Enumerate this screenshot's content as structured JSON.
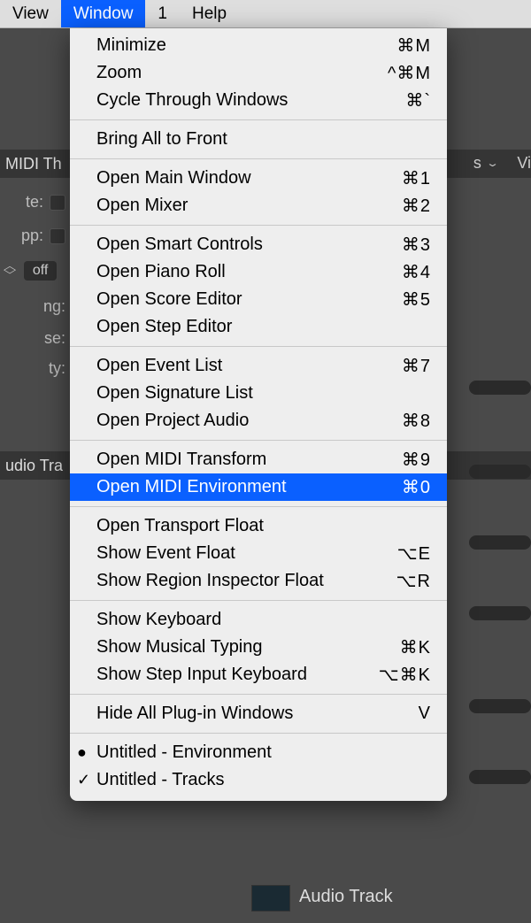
{
  "menubar": {
    "items": [
      "View",
      "Window",
      "1",
      "Help"
    ],
    "active_index": 1
  },
  "background": {
    "header1": "MIDI Th",
    "header2": "udio Tra",
    "labels": {
      "te": "te:",
      "pp": "pp:",
      "off": "off",
      "ng": "ng:",
      "se": "se:",
      "ty": "ty:"
    },
    "right_s": "s",
    "right_v": "Vi",
    "audio_track": "Audio Track"
  },
  "dropdown": {
    "groups": [
      [
        {
          "label": "Minimize",
          "shortcut": "⌘M"
        },
        {
          "label": "Zoom",
          "shortcut": "^⌘M"
        },
        {
          "label": "Cycle Through Windows",
          "shortcut": "⌘`"
        }
      ],
      [
        {
          "label": "Bring All to Front",
          "shortcut": ""
        }
      ],
      [
        {
          "label": "Open Main Window",
          "shortcut": "⌘1"
        },
        {
          "label": "Open Mixer",
          "shortcut": "⌘2"
        }
      ],
      [
        {
          "label": "Open Smart Controls",
          "shortcut": "⌘3"
        },
        {
          "label": "Open Piano Roll",
          "shortcut": "⌘4"
        },
        {
          "label": "Open Score Editor",
          "shortcut": "⌘5"
        },
        {
          "label": "Open Step Editor",
          "shortcut": ""
        }
      ],
      [
        {
          "label": "Open Event List",
          "shortcut": "⌘7"
        },
        {
          "label": "Open Signature List",
          "shortcut": ""
        },
        {
          "label": "Open Project Audio",
          "shortcut": "⌘8"
        }
      ],
      [
        {
          "label": "Open MIDI Transform",
          "shortcut": "⌘9"
        },
        {
          "label": "Open MIDI Environment",
          "shortcut": "⌘0",
          "highlighted": true
        }
      ],
      [
        {
          "label": "Open Transport Float",
          "shortcut": ""
        },
        {
          "label": "Show Event Float",
          "shortcut": "⌥E"
        },
        {
          "label": "Show Region Inspector Float",
          "shortcut": "⌥R"
        }
      ],
      [
        {
          "label": "Show Keyboard",
          "shortcut": ""
        },
        {
          "label": "Show Musical Typing",
          "shortcut": "⌘K"
        },
        {
          "label": "Show Step Input Keyboard",
          "shortcut": "⌥⌘K"
        }
      ],
      [
        {
          "label": "Hide All Plug-in Windows",
          "shortcut": "V"
        }
      ],
      [
        {
          "label": "Untitled - Environment",
          "shortcut": "",
          "marker": "●"
        },
        {
          "label": "Untitled - Tracks",
          "shortcut": "",
          "marker": "✓"
        }
      ]
    ]
  }
}
